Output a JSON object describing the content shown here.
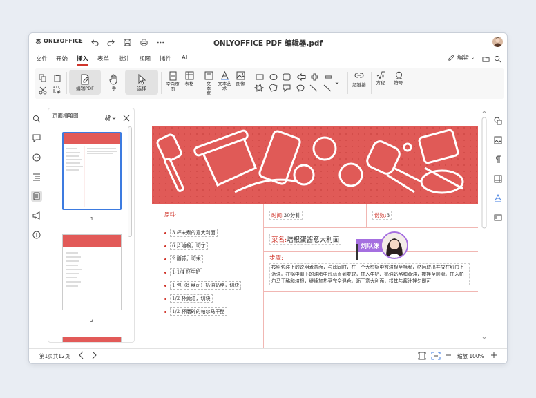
{
  "app": {
    "brand": "ONLYOFFICE",
    "title": "ONLYOFFICE PDF 编辑器.pdf"
  },
  "menu": {
    "items": [
      "文件",
      "开始",
      "插入",
      "表单",
      "批注",
      "视图",
      "插件",
      "AI"
    ],
    "active": "插入",
    "edit_mode": "编辑"
  },
  "toolbar": {
    "edit_pdf": "编辑PDF",
    "hand": "手",
    "select": "选择",
    "blank_page": "空白页面",
    "table": "表格",
    "text_box": "文本框",
    "text_art": "文本艺术",
    "image": "图像",
    "link": "超链接",
    "equation": "方程",
    "symbol": "符号"
  },
  "thumbnails": {
    "title": "页面缩略图",
    "pages": [
      "1",
      "2"
    ]
  },
  "document": {
    "ingredients_label": "原料:",
    "ingredients": [
      "3 杯未煮的意大利面",
      "6 片培根，切丁",
      "2 瓣蒜，切末",
      "1-1/4 杯牛奶",
      "1 包（8 盎司）奶油奶酪，切块",
      "1/2 杯黄油，切块",
      "1/2 杯磨碎的帕尔马干酪"
    ],
    "time_label": "时间:",
    "time_value": "30分钟",
    "servings_label": "份数:",
    "servings_value": "3",
    "dish_label": "菜名:",
    "dish_value": "培根蛋酱意大利面",
    "steps_label": "步骤:",
    "steps_text": "按照包装上的说明煮意面，与此同时，在一个大煎锅中煎培根至酥脆，然后取出并放在纸巾上沥油。在锅中剩下的油脂中炒蒜直到变软，加入牛奶、奶油奶酪和黄油，搅拌至顺滑。加入帕尔马干酪和培根，继续加热至完全混合。沥干意大利面，将其与酱汁拌匀即可"
  },
  "collaborator": {
    "name": "刘以沫"
  },
  "status": {
    "page_info": "第1页共12页",
    "zoom": "缩放 100%"
  },
  "colors": {
    "accent": "#d0352b",
    "banner": "#e05a57",
    "collab": "#a56fe0",
    "selection": "#3d7be0"
  }
}
